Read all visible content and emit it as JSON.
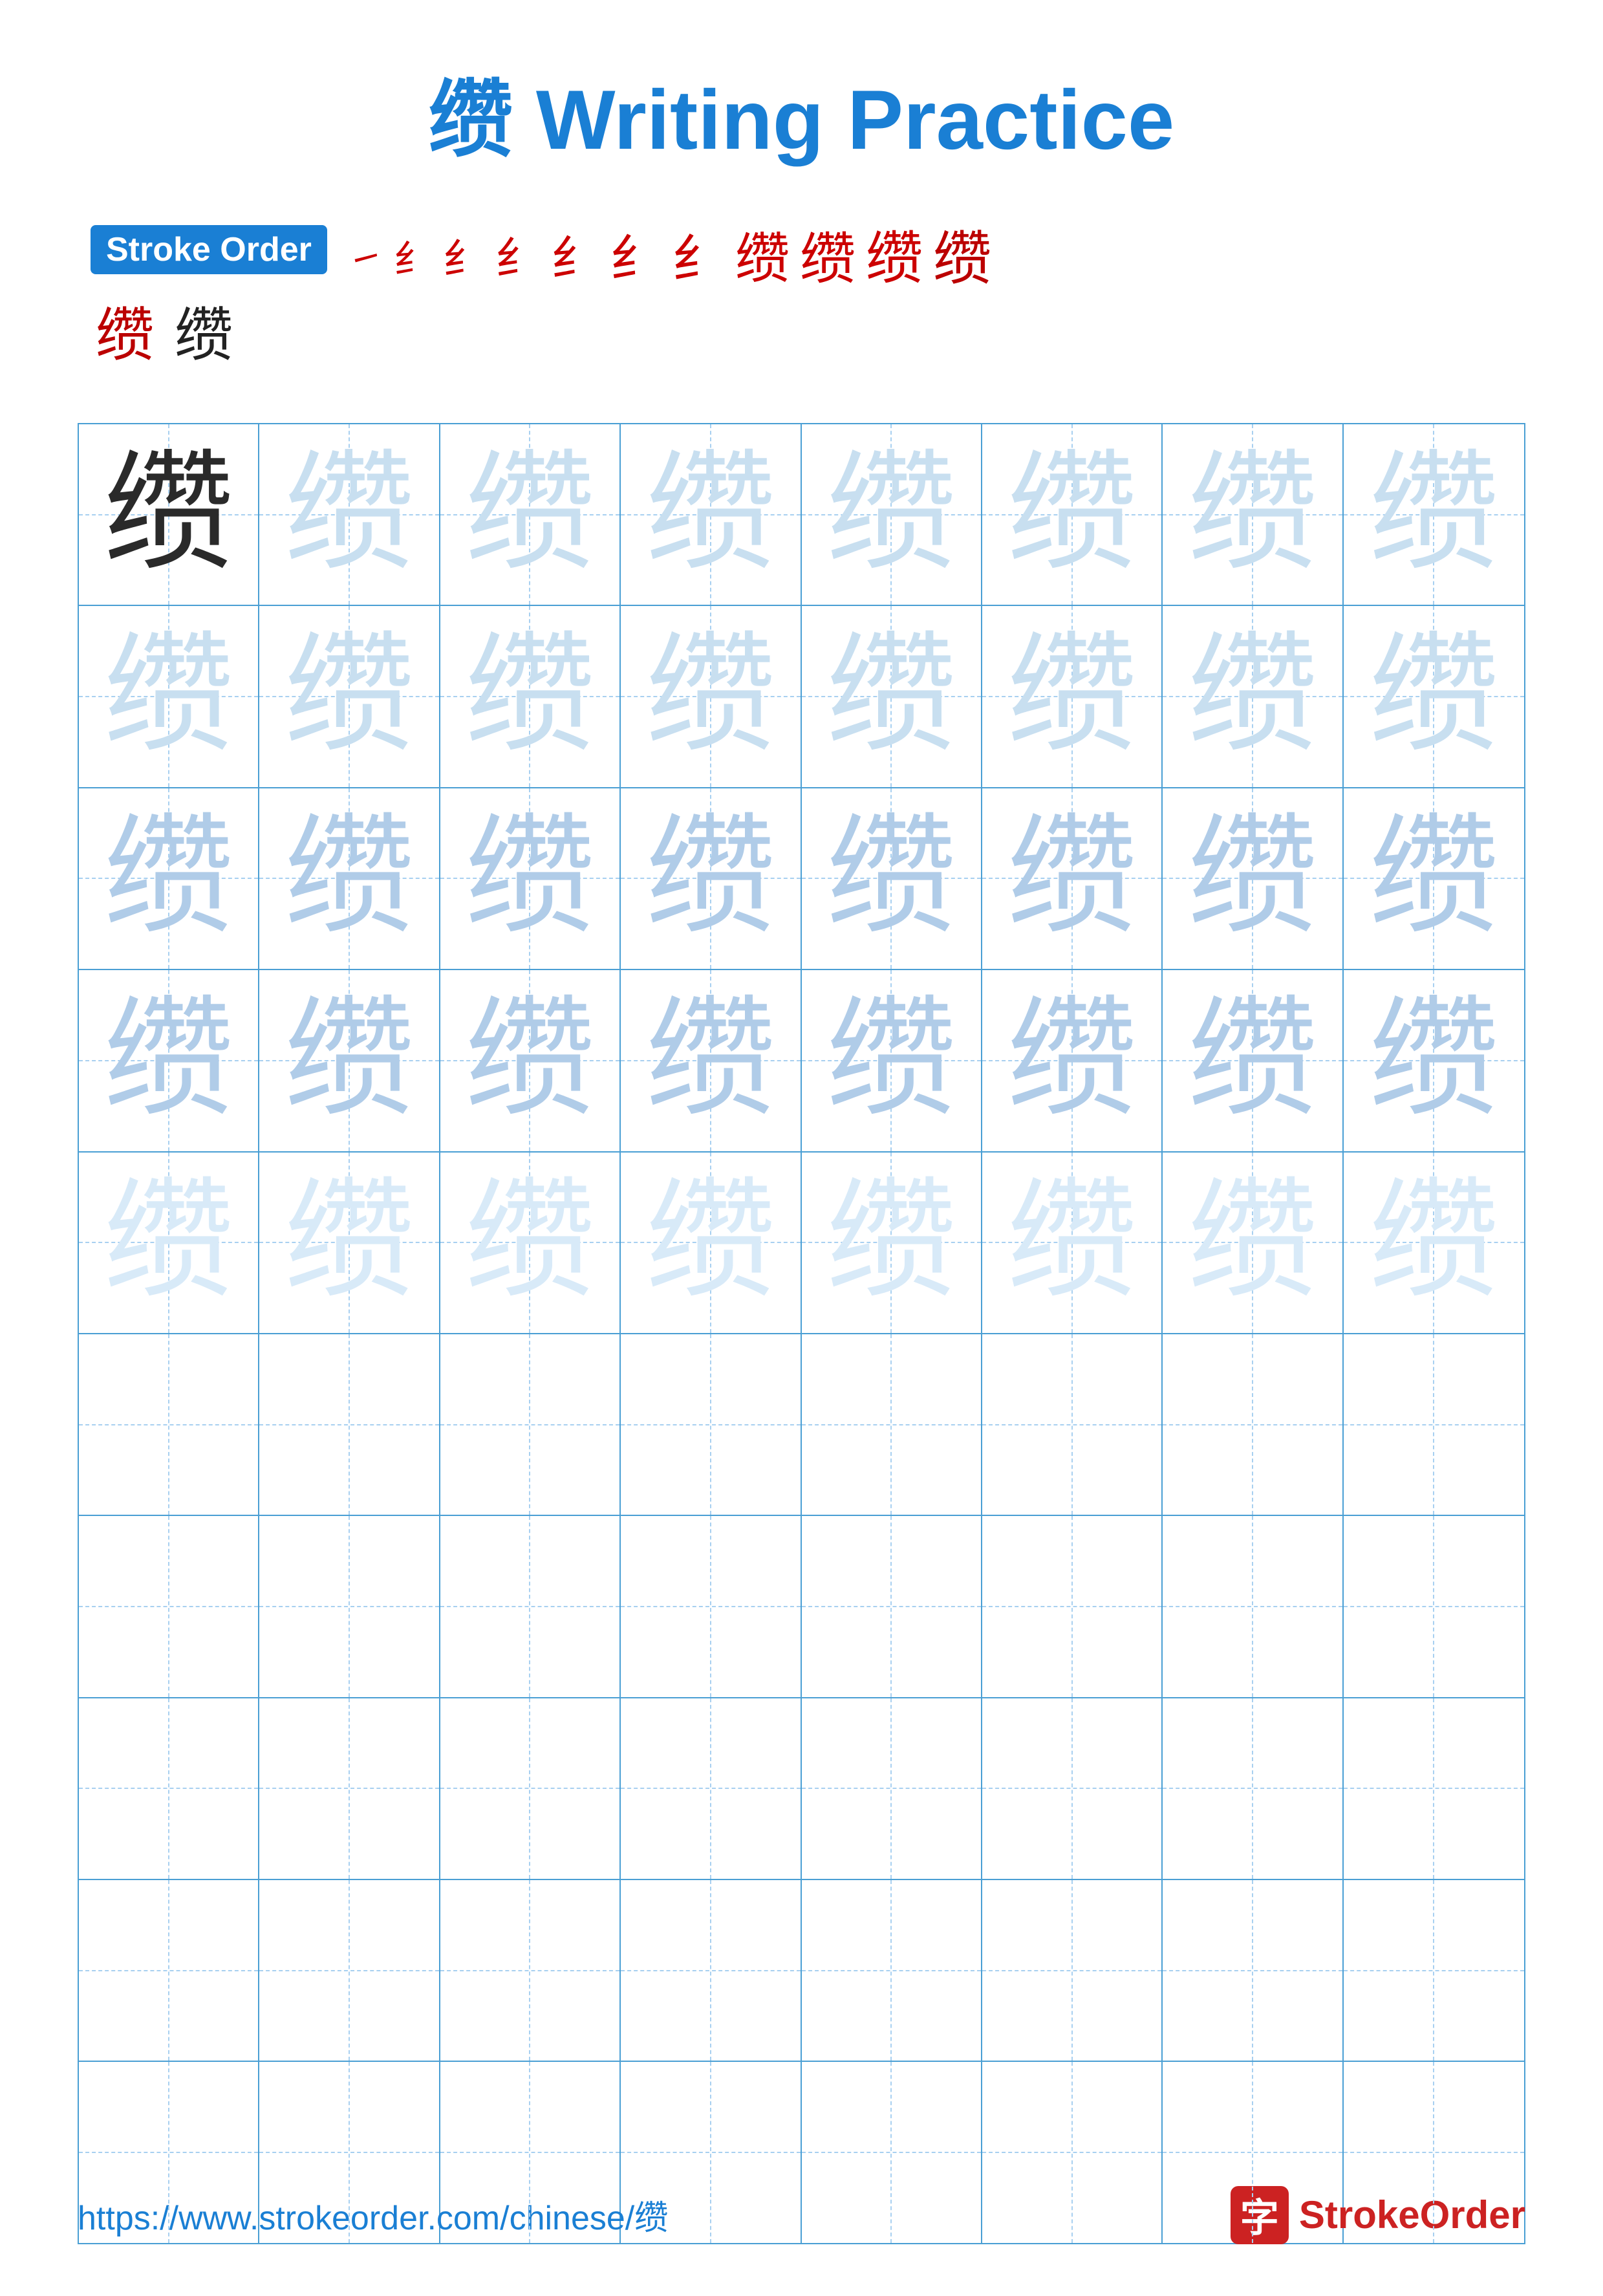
{
  "title": {
    "char": "缵",
    "label": "Writing Practice",
    "full": "缵 Writing Practice"
  },
  "stroke_order": {
    "badge_label": "Stroke Order",
    "chars": [
      "㇀",
      "纟",
      "纟",
      "纟",
      "纟",
      "纟",
      "纟",
      "缵",
      "缵",
      "缵",
      "缵",
      "缵",
      "缵",
      "缵"
    ]
  },
  "grid": {
    "char": "缵",
    "rows": 10,
    "cols": 8,
    "practice_rows": 5,
    "empty_rows": 5
  },
  "footer": {
    "url": "https://www.strokeorder.com/chinese/缵",
    "logo_char": "字",
    "logo_text_stroke": "Stroke",
    "logo_text_order": "Order"
  },
  "colors": {
    "blue": "#1a7fd4",
    "red": "#cc0000",
    "dark_char": "#2a2a2a",
    "light_char": "#c8dff0",
    "medium_char": "#b0cce8",
    "grid_line": "#4a9fd4",
    "dashed": "#a8d0f0"
  }
}
